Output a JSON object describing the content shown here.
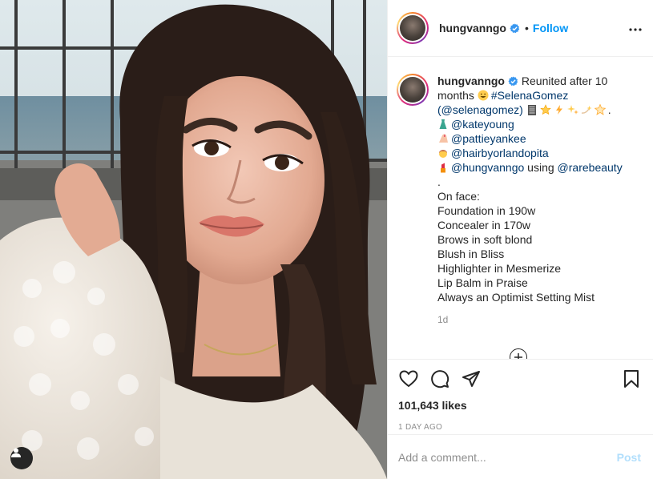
{
  "post": {
    "username": "hungvanngo",
    "follow_label": "Follow",
    "separator": "•",
    "more_label": "•••",
    "caption": {
      "username": "hungvanngo",
      "intro": "Reunited after 10 months",
      "intro_tag": "#SelenaGomez",
      "mention_main": "(@selenagomez)",
      "after_mention": ".",
      "credits": [
        {
          "icon": "dress-emoji",
          "handle": "@kateyoung",
          "suffix": ""
        },
        {
          "icon": "nail-polish-emoji",
          "handle": "@pattieyankee",
          "suffix": ""
        },
        {
          "icon": "haircut-emoji",
          "handle": "@hairbyorlandopita",
          "suffix": ""
        },
        {
          "icon": "lipstick-emoji",
          "handle": "@hungvanngo",
          "suffix": " using ",
          "handle2": "@rarebeauty"
        }
      ],
      "period": ".",
      "on_face_title": "On face:",
      "products": [
        "Foundation in 190w",
        "Concealer in 170w",
        "Brows in soft blond",
        "Blush in Bliss",
        "Highlighter in Mesmerize",
        "Lip Balm in Praise",
        "Always an Optimist Setting Mist"
      ],
      "age": "1d"
    },
    "load_more_label": "+",
    "likes": "101,643 likes",
    "time": "1 DAY AGO",
    "comment_placeholder": "Add a comment...",
    "post_label": "Post"
  },
  "colors": {
    "accent": "#0095f6",
    "tag": "#00376b",
    "muted": "#8e8e8e",
    "post_disabled": "#b2dffc"
  }
}
